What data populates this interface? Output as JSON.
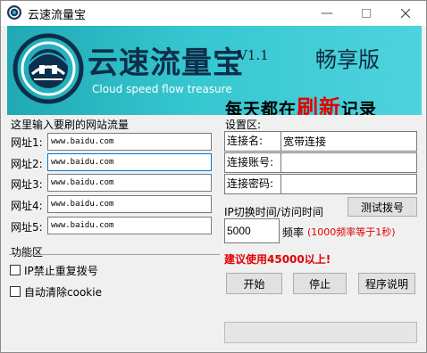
{
  "window": {
    "title": "云速流量宝"
  },
  "banner": {
    "brand": "云速流量宝",
    "version": "V1.1",
    "edition": "畅享版",
    "slogan_en": "Cloud speed flow treasure",
    "slogan_a": "每天都在",
    "slogan_hl": "刷新",
    "slogan_b": "记录"
  },
  "urls": {
    "section_label": "这里输入要刷的网站流量",
    "items": [
      {
        "label": "网址1:",
        "value": "www.baidu.com"
      },
      {
        "label": "网址2:",
        "value": "www.baidu.com"
      },
      {
        "label": "网址3:",
        "value": "www.baidu.com"
      },
      {
        "label": "网址4:",
        "value": "www.baidu.com"
      },
      {
        "label": "网址5:",
        "value": "www.baidu.com"
      }
    ]
  },
  "features": {
    "section_label": "功能区",
    "ip_ban_label": "IP禁止重复拨号",
    "clear_cookie_label": "自动清除cookie"
  },
  "settings": {
    "section_label": "设置区:",
    "conn_name_label": "连接名:",
    "conn_name_value": "宽带连接",
    "account_label": "连接账号:",
    "account_value": "",
    "password_label": "连接密码:",
    "password_value": "",
    "interval_label": "IP切换时间/访问时间",
    "test_dial_button": "测试拨号",
    "frequency_value": "5000",
    "frequency_label": "频率",
    "frequency_note": "(1000频率等于1秒)",
    "recommend": "建议使用45000以上!"
  },
  "actions": {
    "start": "开始",
    "stop": "停止",
    "help": "程序说明"
  },
  "colors": {
    "banner": "#36c7d0",
    "warning": "#e00000",
    "focus": "#0078d7"
  }
}
